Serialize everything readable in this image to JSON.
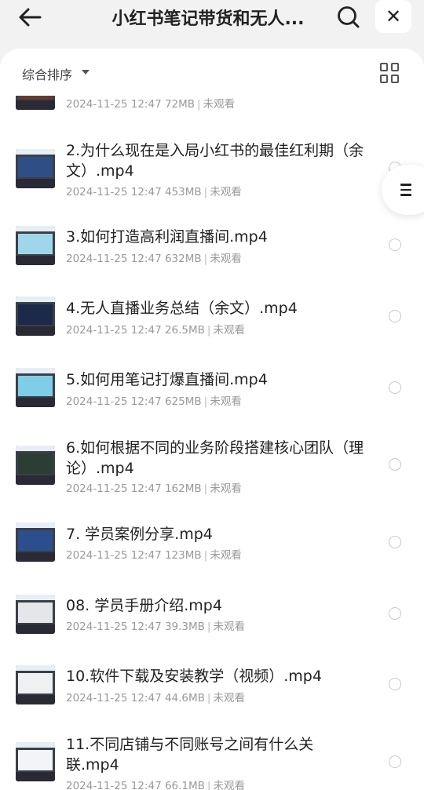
{
  "header": {
    "title": "小红书笔记带货和无人...",
    "back_icon": "arrow-left-icon",
    "search_icon": "search-icon",
    "close_label": "✕"
  },
  "sort": {
    "label": "综合排序",
    "view_icon": "grid-view-icon"
  },
  "files": [
    {
      "name": "",
      "date": "2024-11-25 12:47",
      "size": "72MB",
      "status": "未观看",
      "thumb_screen": "#6a3a28"
    },
    {
      "name": "2.为什么现在是入局小红书的最佳红利期（余文）.mp4",
      "date": "2024-11-25 12:47",
      "size": "453MB",
      "status": "未观看",
      "thumb_screen": "#2f4e86"
    },
    {
      "name": "3.如何打造高利润直播间.mp4",
      "date": "2024-11-25 12:47",
      "size": "632MB",
      "status": "未观看",
      "thumb_screen": "#9fd6ea"
    },
    {
      "name": "4.无人直播业务总结（余文）.mp4",
      "date": "2024-11-25 12:47",
      "size": "26.5MB",
      "status": "未观看",
      "thumb_screen": "#1b2a4a"
    },
    {
      "name": "5.如何用笔记打爆直播间.mp4",
      "date": "2024-11-25 12:47",
      "size": "625MB",
      "status": "未观看",
      "thumb_screen": "#7fcde6"
    },
    {
      "name": "6.如何根据不同的业务阶段搭建核心团队（理论）.mp4",
      "date": "2024-11-25 12:47",
      "size": "162MB",
      "status": "未观看",
      "thumb_screen": "#2c3e34"
    },
    {
      "name": "7. 学员案例分享.mp4",
      "date": "2024-11-25 12:47",
      "size": "123MB",
      "status": "未观看",
      "thumb_screen": "#2b4f8c"
    },
    {
      "name": "08. 学员手册介绍.mp4",
      "date": "2024-11-25 12:47",
      "size": "39.3MB",
      "status": "未观看",
      "thumb_screen": "#e4e6ea"
    },
    {
      "name": "10.软件下载及安装教学（视频）.mp4",
      "date": "2024-11-25 12:47",
      "size": "44.6MB",
      "status": "未观看",
      "thumb_screen": "#eef0f2"
    },
    {
      "name": "11.不同店铺与不同账号之间有什么关联.mp4",
      "date": "2024-11-25 12:47",
      "size": "66.1MB",
      "status": "未观看",
      "thumb_screen": "#f2f4f7"
    }
  ],
  "floating_menu_icon": "menu-lines-icon"
}
